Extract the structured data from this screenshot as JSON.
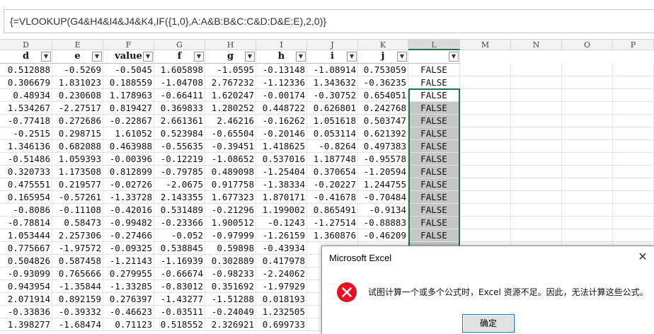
{
  "formula_bar": {
    "text": "{=VLOOKUP(G4&H4&I4&J4&K4,IF({1,0},A:A&B:B&C:C&D:D&E:E),2,0)}"
  },
  "columns": [
    "D",
    "E",
    "F",
    "G",
    "H",
    "I",
    "J",
    "K",
    "L",
    "M",
    "N",
    "O",
    "P"
  ],
  "filters": [
    "d",
    "e",
    "value",
    "f",
    "g",
    "h",
    "i",
    "j",
    ""
  ],
  "rows": [
    [
      "0.512888",
      "-0.5269",
      "-0.5045",
      "1.605898",
      "-1.0595",
      "-0.13148",
      "-1.08914",
      "0.753059",
      "FALSE"
    ],
    [
      "0.306679",
      "1.831023",
      "0.188559",
      "-1.04708",
      "2.767232",
      "-1.12336",
      "1.343632",
      "-0.36235",
      "FALSE"
    ],
    [
      "0.48934",
      "0.230608",
      "1.178963",
      "-0.66411",
      "1.620247",
      "-0.00174",
      "-0.30752",
      "0.654051",
      "FALSE"
    ],
    [
      "1.534267",
      "-2.27517",
      "0.819427",
      "0.369833",
      "1.280252",
      "0.448722",
      "0.626801",
      "0.242768",
      "FALSE"
    ],
    [
      "-0.77418",
      "0.272686",
      "-0.22867",
      "2.661361",
      "2.46216",
      "-0.16262",
      "1.051618",
      "0.503747",
      "FALSE"
    ],
    [
      "-0.2515",
      "0.298715",
      "1.61052",
      "0.523984",
      "-0.65504",
      "-0.20146",
      "0.053114",
      "0.621392",
      "FALSE"
    ],
    [
      "1.346136",
      "0.682088",
      "0.463988",
      "-0.55635",
      "-0.39451",
      "1.418625",
      "-0.8264",
      "0.497383",
      "FALSE"
    ],
    [
      "-0.51486",
      "1.059393",
      "-0.00396",
      "-0.12219",
      "-1.08652",
      "0.537016",
      "1.187748",
      "-0.95578",
      "FALSE"
    ],
    [
      "0.320733",
      "1.173508",
      "0.812899",
      "-0.79785",
      "0.489098",
      "-1.25404",
      "0.370654",
      "-1.20594",
      "FALSE"
    ],
    [
      "0.475551",
      "0.219577",
      "-0.02726",
      "-2.0675",
      "0.917758",
      "-1.38334",
      "-0.20227",
      "1.244755",
      "FALSE"
    ],
    [
      "0.165954",
      "-0.57261",
      "-1.33728",
      "2.143355",
      "1.677323",
      "1.870171",
      "-0.41678",
      "-0.70484",
      "FALSE"
    ],
    [
      "-0.8086",
      "-0.11108",
      "-0.42016",
      "0.531489",
      "-0.21296",
      "1.199002",
      "0.865491",
      "-0.9134",
      "FALSE"
    ],
    [
      "-0.78814",
      "0.58473",
      "-0.99482",
      "-0.23366",
      "1.900512",
      "-0.1243",
      "-1.27514",
      "-0.88883",
      "FALSE"
    ],
    [
      "1.053444",
      "2.257306",
      "-0.27466",
      "-0.052",
      "-0.97999",
      "-1.26159",
      "1.360876",
      "-0.46209",
      "FALSE"
    ],
    [
      "0.775667",
      "-1.97572",
      "-0.09325",
      "0.538845",
      "0.59898",
      "-0.43934",
      "",
      "",
      ""
    ],
    [
      "0.504826",
      "0.587458",
      "-1.21143",
      "-1.16939",
      "0.302889",
      "0.417978",
      "",
      "",
      ""
    ],
    [
      "-0.93099",
      "0.765666",
      "0.279955",
      "-0.66674",
      "-0.98233",
      "-2.24062",
      "",
      "",
      ""
    ],
    [
      "0.943954",
      "-1.35844",
      "-1.33285",
      "-0.83012",
      "0.351692",
      "-1.97929",
      "",
      "",
      ""
    ],
    [
      "2.071914",
      "0.892159",
      "0.276397",
      "-1.43277",
      "-1.51288",
      "0.018193",
      "",
      "",
      ""
    ],
    [
      "-0.33836",
      "-0.39332",
      "-0.46623",
      "-0.03511",
      "-0.24049",
      "1.232505",
      "",
      "",
      ""
    ],
    [
      "1.398277",
      "-1.68474",
      "0.71123",
      "0.518552",
      "2.326921",
      "0.699733",
      "",
      "",
      ""
    ]
  ],
  "dialog": {
    "title": "Microsoft Excel",
    "message": "试图计算一个或多个公式时，Excel 资源不足。因此，无法计算这些公式。",
    "ok": "确定",
    "close": "✕",
    "icon": "error-icon"
  },
  "colors": {
    "accent": "#217346",
    "error": "#e81123",
    "selected_fill": "#c6c6c6"
  }
}
